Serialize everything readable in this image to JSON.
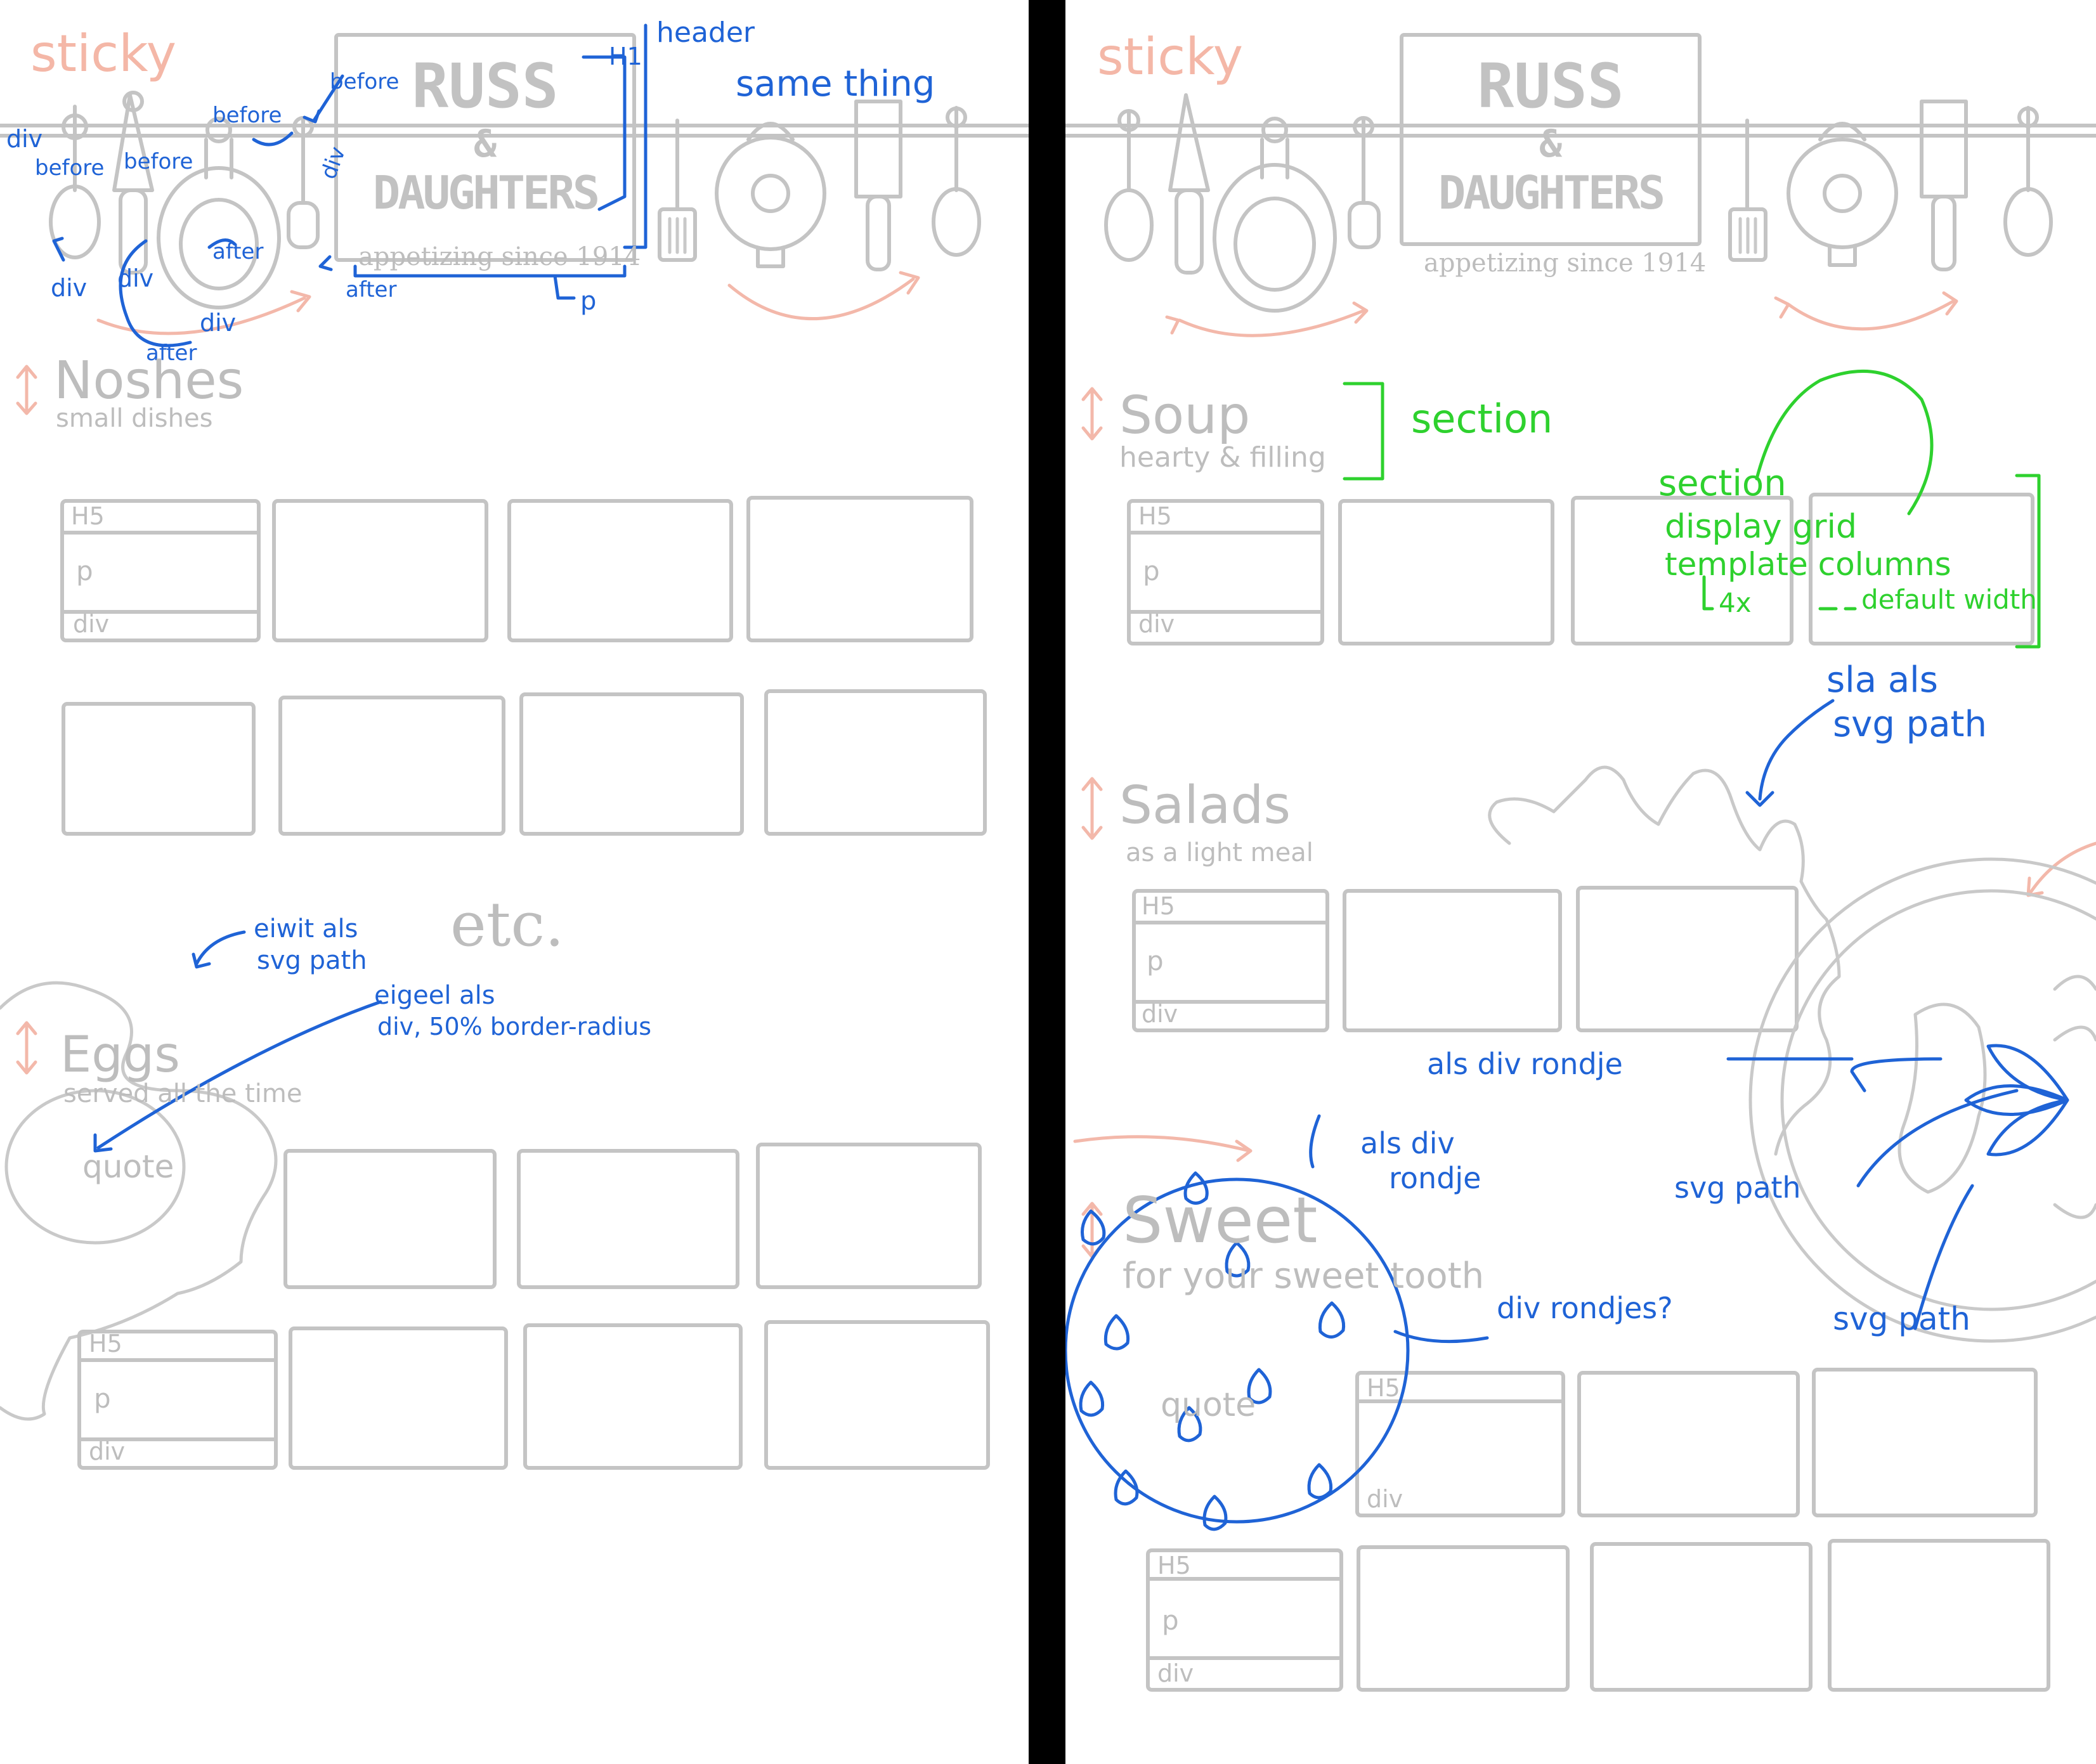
{
  "colors": {
    "sketch_gray": "#c4c4c4",
    "annotation_blue": "#1f63d6",
    "annotation_green": "#2ed12e",
    "accent_pink": "#f3b8aa",
    "background": "#ffffff",
    "divider": "#000000"
  },
  "logo": {
    "line1": "RUSS",
    "line2": "&",
    "line3": "DAUGHTERS",
    "tagline": "appetizing since 1914"
  },
  "left": {
    "sticky": "sticky",
    "annotations": {
      "header": "header",
      "h1": "H1",
      "p": "p",
      "same_thing": "same thing",
      "div": "div",
      "before": "before",
      "after": "after",
      "eiwit": "eiwit als",
      "eiwit2": "svg path",
      "eigeel": "eigeel als",
      "eigeel2": "div, 50% border-radius"
    },
    "sections": [
      {
        "title": "Noshes",
        "subtitle": "small dishes"
      },
      {
        "title": "Eggs",
        "subtitle": "served all the time",
        "quote": "quote"
      }
    ],
    "etc": "etc.",
    "card": {
      "h5": "H5",
      "p": "p",
      "div": "div"
    }
  },
  "right": {
    "sticky": "sticky",
    "sections": [
      {
        "title": "Soup",
        "subtitle": "hearty & filling"
      },
      {
        "title": "Salads",
        "subtitle": "as a light meal"
      },
      {
        "title": "Sweet",
        "subtitle": "for your sweet tooth",
        "quote": "quote"
      }
    ],
    "annotations": {
      "section": "section",
      "section2": "section",
      "display_grid": "display grid",
      "template_columns": "template columns",
      "rem": "4x",
      "default_width": "default width",
      "sla": "sla als",
      "sla2": "svg path",
      "als_div_rondje": "als div rondje",
      "svg_path": "svg path",
      "svg_path2": "svg path",
      "als_div": "als div",
      "rondje": "rondje",
      "div_rondjes": "div rondjes?"
    },
    "card": {
      "h5": "H5",
      "p": "p",
      "div": "div"
    }
  }
}
